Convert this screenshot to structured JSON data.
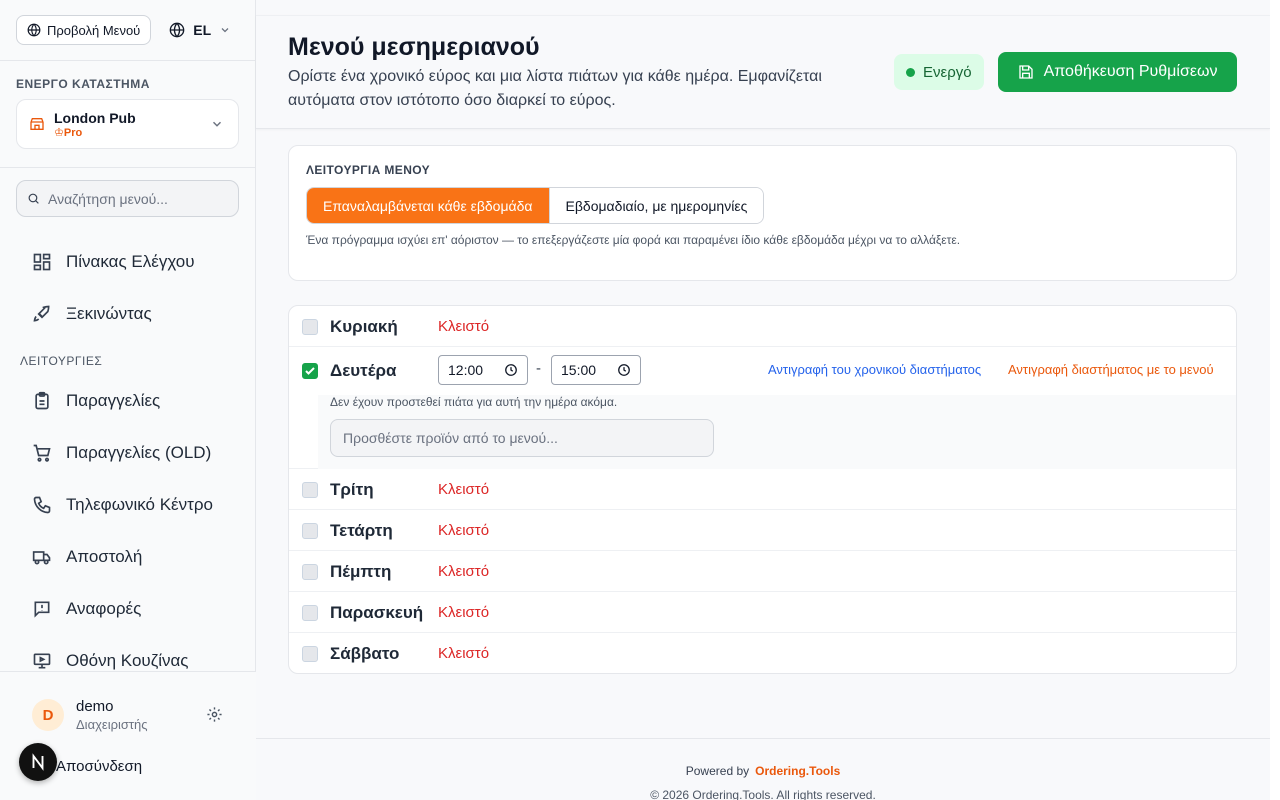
{
  "sidebar": {
    "view_menu_label": "Προβολή Μενού",
    "language": "EL",
    "active_store_caption": "ΕΝΕΡΓΟ ΚΑΤΑΣΤΗΜΑ",
    "store_name": "London Pub",
    "store_plan": "Pro",
    "search_placeholder": "Αναζήτηση μενού...",
    "items_top": [
      {
        "label": "Πίνακας Ελέγχου",
        "icon": "dashboard-grid-icon"
      },
      {
        "label": "Ξεκινώντας",
        "icon": "rocket-icon"
      }
    ],
    "features_caption": "ΛΕΙΤΟΥΡΓΙΕΣ",
    "items": [
      {
        "label": "Παραγγελίες",
        "icon": "clipboard-icon"
      },
      {
        "label": "Παραγγελίες (OLD)",
        "icon": "cart-icon"
      },
      {
        "label": "Τηλεφωνικό Κέντρο",
        "icon": "phone-icon"
      },
      {
        "label": "Αποστολή",
        "icon": "truck-icon"
      },
      {
        "label": "Αναφορές",
        "icon": "report-icon"
      },
      {
        "label": "Οθόνη Κουζίνας",
        "icon": "monitor-icon"
      }
    ],
    "user": {
      "initial": "D",
      "name": "demo",
      "role": "Διαχειριστής"
    },
    "logout_label": "Αποσύνδεση"
  },
  "header": {
    "title": "Μενού μεσημεριανού",
    "subtitle": "Ορίστε ένα χρονικό εύρος και μια λίστα πιάτων για κάθε ημέρα. Εμφανίζεται αυτόματα στον ιστότοπο όσο διαρκεί το εύρος.",
    "status": "Ενεργό",
    "save_label": "Αποθήκευση Ρυθμίσεων"
  },
  "mode": {
    "caption": "ΛΕΙΤΟΥΡΓΙΑ ΜΕΝΟΥ",
    "option_weekly": "Επαναλαμβάνεται κάθε εβδομάδα",
    "option_dated": "Εβδομαδιαίο, με ημερομηνίες",
    "selected": "Επαναλαμβάνεται κάθε εβδομάδα",
    "help": "Ένα πρόγραμμα ισχύει επ' αόριστον — το επεξεργάζεστε μία φορά και παραμένει ίδιο κάθε εβδομάδα μέχρι να το αλλάξετε."
  },
  "days": {
    "closed_label": "Κλειστό",
    "sunday": "Κυριακή",
    "monday": "Δευτέρα",
    "tuesday": "Τρίτη",
    "wednesday": "Τετάρτη",
    "thursday": "Πέμπτη",
    "friday": "Παρασκευή",
    "saturday": "Σάββατο",
    "monday_start": "12:00",
    "monday_end": "15:00",
    "copy_time_label": "Αντιγραφή του χρονικού διαστήματος",
    "copy_with_menu_label": "Αντιγραφή διαστήματος με το μενού",
    "no_dishes": "Δεν έχουν προστεθεί πιάτα για αυτή την ημέρα ακόμα.",
    "add_product_placeholder": "Προσθέστε προϊόν από το μενού..."
  },
  "footer": {
    "powered_by": "Powered by",
    "brand": "Ordering.Tools",
    "copyright": "© 2026 Ordering.Tools. All rights reserved."
  },
  "colors": {
    "accent_orange": "#f97316",
    "success_green": "#16a34a",
    "closed_red": "#dc2626",
    "link_blue": "#2563eb"
  }
}
